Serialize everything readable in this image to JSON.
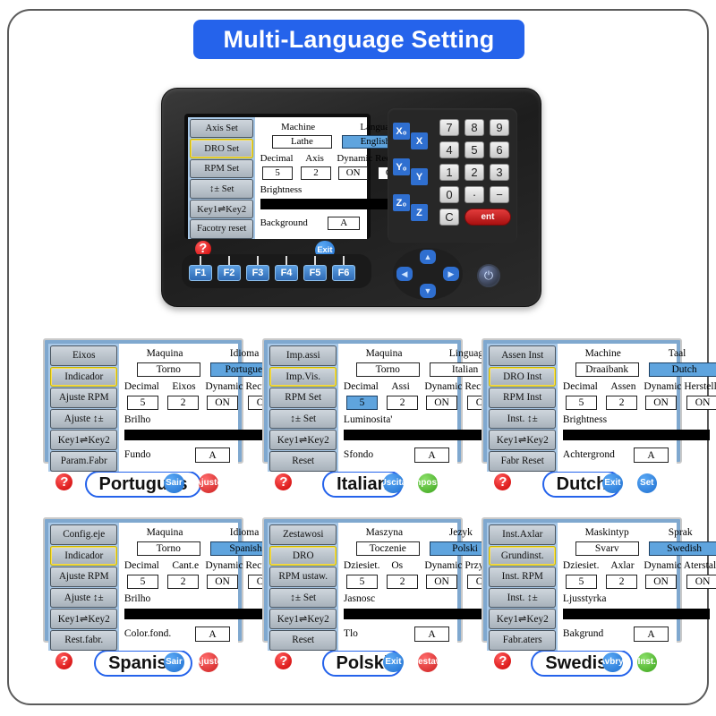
{
  "banner": {
    "title": "Multi-Language Setting"
  },
  "device": {
    "screen": {
      "menu": [
        "Axis Set",
        "DRO Set",
        "RPM  Set",
        "↕±  Set",
        "Key1⇌Key2",
        "Facotry reset"
      ],
      "selected_menu_index": 1,
      "machine_label": "Machine",
      "machine_value": "Lathe",
      "language_label": "Language",
      "language_value": "English",
      "decimal_label": "Decimal",
      "decimal_value": "5",
      "axis_label": "Axis",
      "axis_value": "2",
      "dynamic_label": "Dynamic Recovery",
      "dynamic_value_1": "ON",
      "dynamic_value_2": "ON",
      "brightness_label": "Brightness",
      "background_label": "Background",
      "background_value": "A",
      "help_glyph": "?",
      "footer_buttons": [
        {
          "label": "Exit",
          "color": "blue"
        }
      ],
      "highlight": "language"
    },
    "keypad": {
      "axis_keys": [
        "X₀",
        "X",
        "Y₀",
        "Y",
        "Z₀",
        "Z"
      ],
      "number_keys": [
        "7",
        "8",
        "9",
        "4",
        "5",
        "6",
        "1",
        "2",
        "3",
        "0",
        "·",
        "−"
      ],
      "clear_key": "C",
      "enter_key": "ent"
    },
    "fkeys": [
      "F1",
      "F2",
      "F3",
      "F4",
      "F5",
      "F6"
    ],
    "dpad": [
      "up",
      "down",
      "left",
      "right"
    ],
    "power_glyph": "⏻"
  },
  "panels": [
    {
      "caption": "Portugues",
      "menu": [
        "Eixos",
        "Indicador",
        "Ajuste RPM",
        "Ajuste ↕±",
        "Key1⇌Key2",
        "Param.Fabr"
      ],
      "selected_menu_index": 1,
      "machine_label": "Maquina",
      "machine_value": "Torno",
      "language_label": "Idioma",
      "language_value": "Portugues",
      "decimal_label": "Decimal",
      "decimal_value": "5",
      "axis_label": "Eixos",
      "axis_value": "2",
      "dynamic_label": "Dynamic Recuperar",
      "dynamic_value_1": "ON",
      "dynamic_value_2": "ON",
      "brightness_label": "Brilho",
      "background_label": "Fundo",
      "background_value": "A",
      "help_glyph": "?",
      "footer_buttons": [
        {
          "label": "Sair",
          "color": "blue"
        },
        {
          "label": "Ajuste",
          "color": "red"
        }
      ],
      "highlight": "language"
    },
    {
      "caption": "Italian",
      "menu": [
        "Imp.assi",
        "Imp.Vis.",
        "RPM  Set",
        "↕±  Set",
        "Key1⇌Key2",
        "Reset"
      ],
      "selected_menu_index": 1,
      "machine_label": "Maquina",
      "machine_value": "Torno",
      "language_label": "Linguaggi",
      "language_value": "Italian",
      "decimal_label": "Decimal",
      "decimal_value": "5",
      "axis_label": "Assi",
      "axis_value": "2",
      "dynamic_label": "Dynamic Recupero",
      "dynamic_value_1": "ON",
      "dynamic_value_2": "ON",
      "brightness_label": "Luminosita'",
      "background_label": "Sfondo",
      "background_value": "A",
      "help_glyph": "?",
      "footer_buttons": [
        {
          "label": "Uscita",
          "color": "blue"
        },
        {
          "label": "Imposta",
          "color": "green"
        }
      ],
      "highlight": "decimal"
    },
    {
      "caption": "Dutch",
      "menu": [
        "Assen Inst",
        "DRO Inst",
        "RPM Inst",
        "Inst.  ↕±",
        "Key1⇌Key2",
        "Fabr Reset"
      ],
      "selected_menu_index": 1,
      "machine_label": "Machine",
      "machine_value": "Draaibank",
      "language_label": "Taal",
      "language_value": "Dutch",
      "decimal_label": "Decimal",
      "decimal_value": "5",
      "axis_label": "Assen",
      "axis_value": "2",
      "dynamic_label": "Dynamic Herstellen",
      "dynamic_value_1": "ON",
      "dynamic_value_2": "ON",
      "brightness_label": "Brightness",
      "background_label": "Achtergrond",
      "background_value": "A",
      "help_glyph": "?",
      "footer_buttons": [
        {
          "label": "Exit",
          "color": "blue"
        },
        {
          "label": "Set",
          "color": "blue"
        }
      ],
      "highlight": "language"
    },
    {
      "caption": "Spanish",
      "menu": [
        "Config.eje",
        "Indicador",
        "Ajuste RPM",
        "Ajuste ↕±",
        "Key1⇌Key2",
        "Rest.fabr."
      ],
      "selected_menu_index": 1,
      "machine_label": "Maquina",
      "machine_value": "Torno",
      "language_label": "Idioma",
      "language_value": "Spanish",
      "decimal_label": "Decimal",
      "decimal_value": "5",
      "axis_label": "Cant.e",
      "axis_value": "2",
      "dynamic_label": "Dynamic Recuperar",
      "dynamic_value_1": "ON",
      "dynamic_value_2": "ON",
      "brightness_label": "Brilho",
      "background_label": "Color.fond.",
      "background_value": "A",
      "help_glyph": "?",
      "footer_buttons": [
        {
          "label": "Sair",
          "color": "blue"
        },
        {
          "label": "Ajuste",
          "color": "red"
        }
      ],
      "highlight": "language"
    },
    {
      "caption": "Polski",
      "menu": [
        "Zestawosi",
        "DRO",
        "RPM ustaw.",
        "↕±  Set",
        "Key1⇌Key2",
        "Reset"
      ],
      "selected_menu_index": 1,
      "machine_label": "Maszyna",
      "machine_value": "Toczenie",
      "language_label": "Jezyk",
      "language_value": "Polski",
      "decimal_label": "Dziesiet.",
      "decimal_value": "5",
      "axis_label": "Os",
      "axis_value": "2",
      "dynamic_label": "Dynamic Przywroocenie",
      "dynamic_value_1": "ON",
      "dynamic_value_2": "ON",
      "brightness_label": "Jasnosc",
      "background_label": "Tlo",
      "background_value": "A",
      "help_glyph": "?",
      "footer_buttons": [
        {
          "label": "Exit",
          "color": "blue"
        },
        {
          "label": "Zestaw",
          "color": "red"
        }
      ],
      "highlight": "language"
    },
    {
      "caption": "Swedish",
      "menu": [
        "Inst.Axlar",
        "Grundinst.",
        "Inst. RPM",
        "Inst. ↕±",
        "Key1⇌Key2",
        "Fabr.aters"
      ],
      "selected_menu_index": 1,
      "machine_label": "Maskintyp",
      "machine_value": "Svarv",
      "language_label": "Sprak",
      "language_value": "Swedish",
      "decimal_label": "Dziesiet.",
      "decimal_value": "5",
      "axis_label": "Axlar",
      "axis_value": "2",
      "dynamic_label": "Dynamic Aterstall",
      "dynamic_value_1": "ON",
      "dynamic_value_2": "ON",
      "brightness_label": "Ljusstyrka",
      "background_label": "Bakgrund",
      "background_value": "A",
      "help_glyph": "?",
      "footer_buttons": [
        {
          "label": "Avbryt",
          "color": "blue"
        },
        {
          "label": "Inst.",
          "color": "green"
        }
      ],
      "highlight": "language"
    }
  ],
  "colors": {
    "banner_blue": "#2563eb",
    "screen_blue": "#7fa8cf",
    "highlight_blue": "#5fa4de",
    "key_blue": "#2f6fd0",
    "red": "#cc1f1f",
    "green": "#3aa31a"
  }
}
